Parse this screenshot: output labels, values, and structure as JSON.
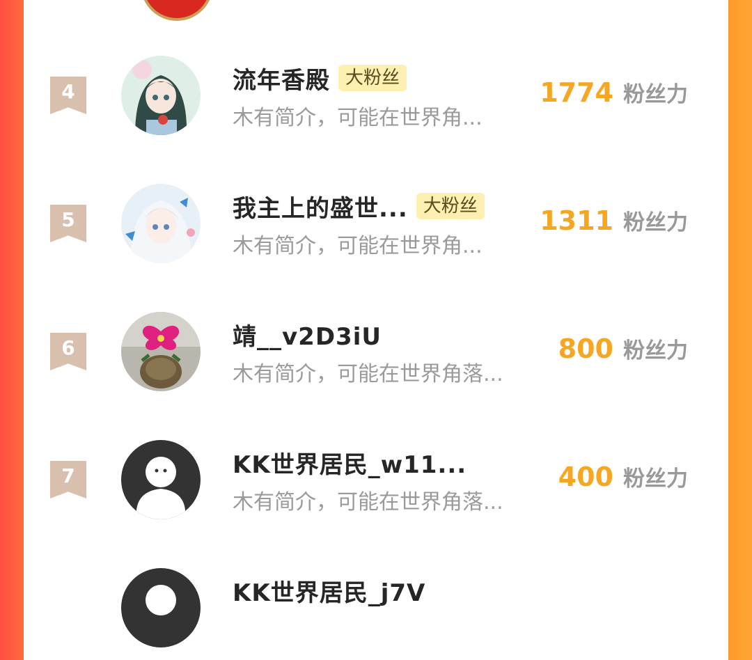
{
  "colors": {
    "accent_left": "#ff4e42",
    "accent_right": "#ffa533",
    "score": "#f5a623",
    "badge_bg": "#fdf0b0",
    "rank_bg": "#d8bfae"
  },
  "score_unit": "粉丝力",
  "rows": [
    {
      "rank": "4",
      "name": "流年香殿",
      "badge": "大粉丝",
      "bio": "木有简介，可能在世界角...",
      "score": "1774",
      "avatar": "anime-girl-dark-hair-avatar"
    },
    {
      "rank": "5",
      "name": "我主上的盛世...",
      "badge": "大粉丝",
      "bio": "木有简介，可能在世界角...",
      "score": "1311",
      "avatar": "anime-girl-white-hair-avatar"
    },
    {
      "rank": "6",
      "name": "靖__v2D3iU",
      "badge": "",
      "bio": "木有简介，可能在世界角落...",
      "score": "800",
      "avatar": "orchid-flower-avatar"
    },
    {
      "rank": "7",
      "name": "KK世界居民_w11...",
      "badge": "",
      "bio": "木有简介，可能在世界角落...",
      "score": "400",
      "avatar": "default-user-avatar"
    },
    {
      "rank": "",
      "name": "KK世界居民_j7V",
      "badge": "",
      "bio": "",
      "score": "",
      "avatar": "default-user-avatar"
    }
  ]
}
